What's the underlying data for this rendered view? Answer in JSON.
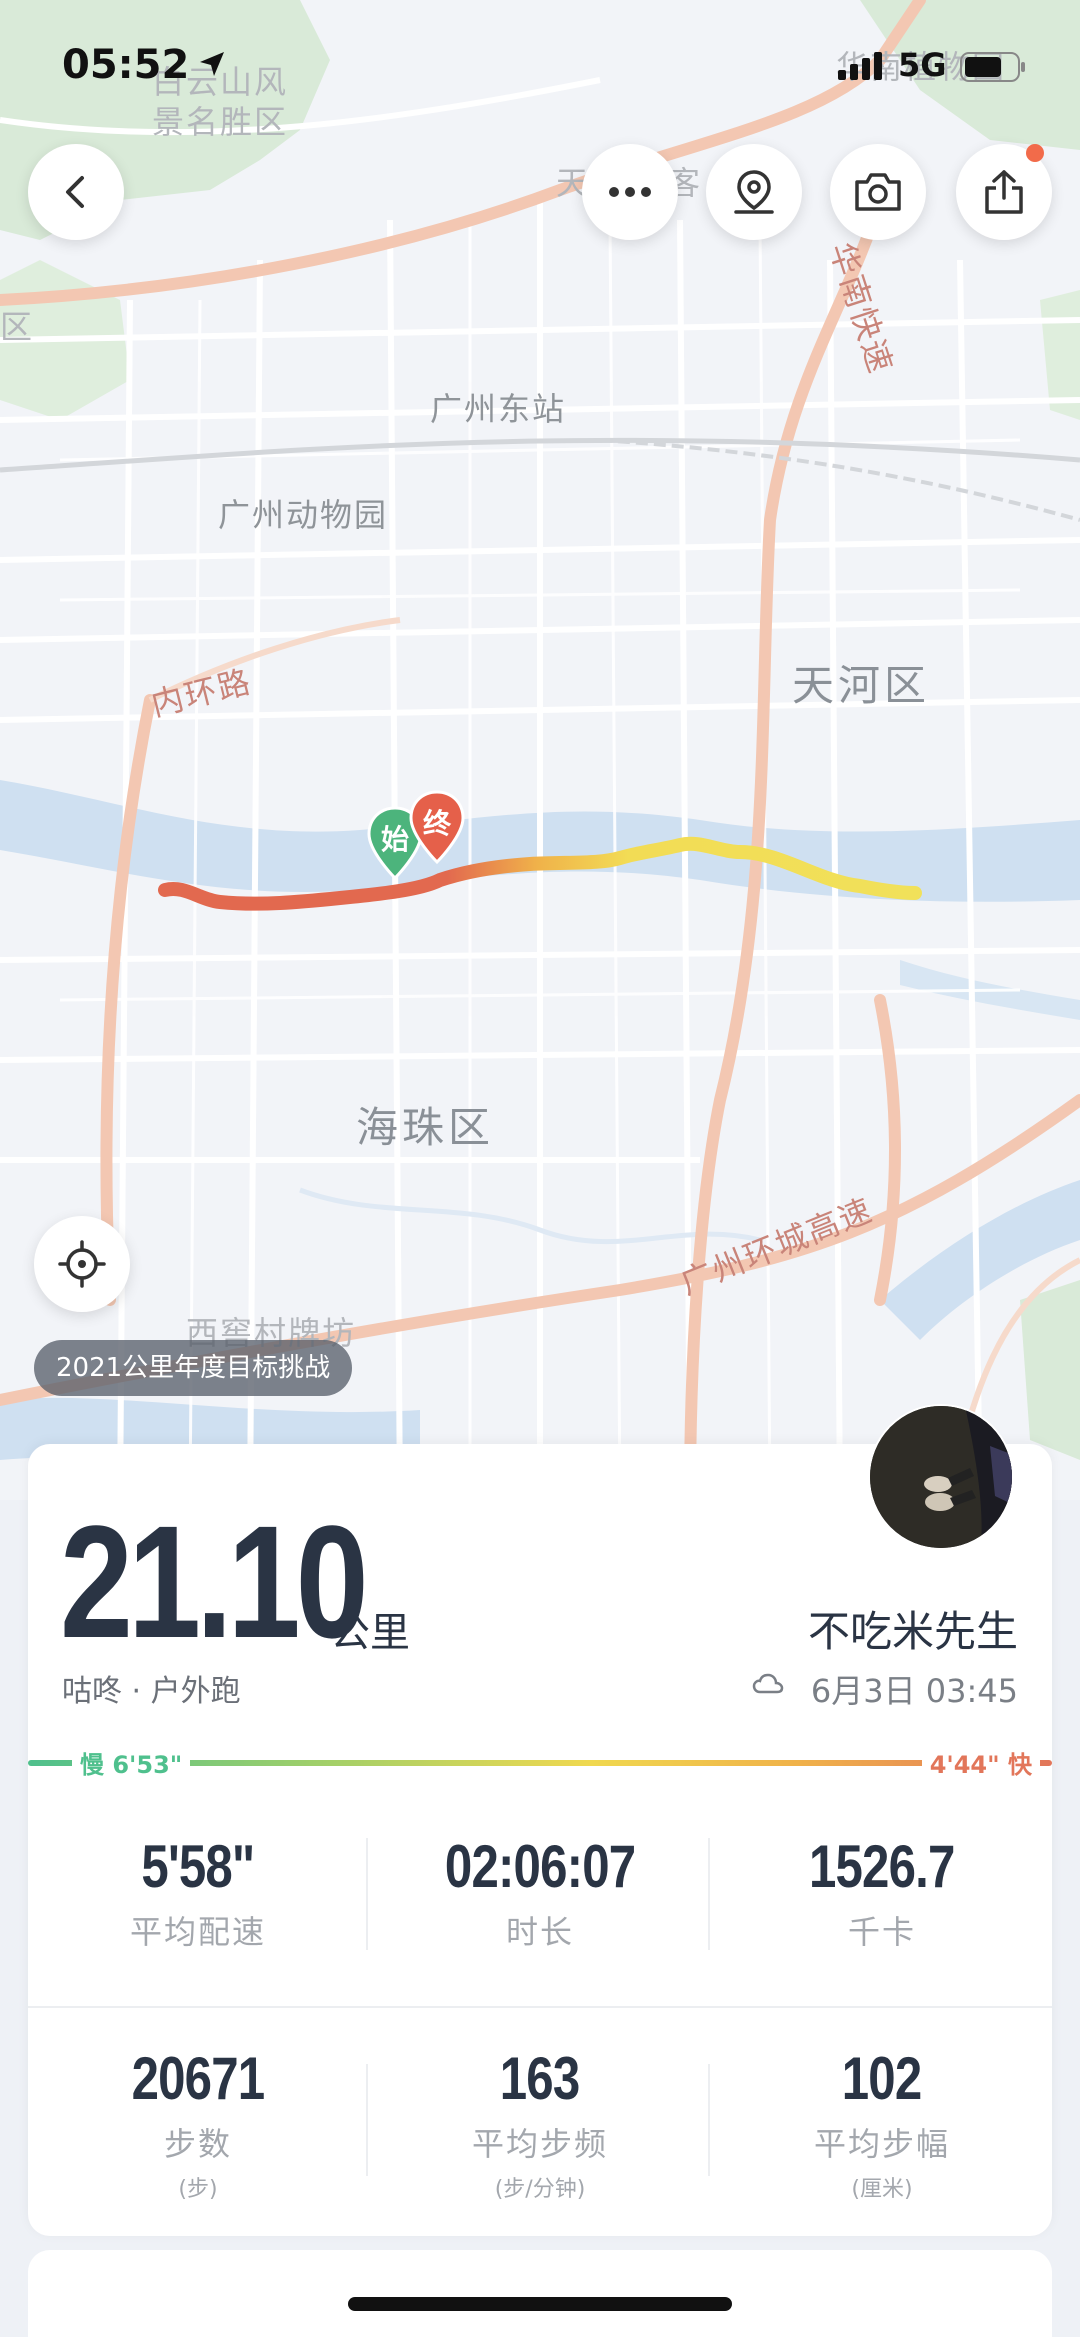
{
  "status_bar": {
    "time": "05:52",
    "network": "5G"
  },
  "map": {
    "labels": {
      "baiyun": "白云山风\n景名胜区",
      "dongzhan": "广州东站",
      "zoo": "广州动物园",
      "tianhe": "天河区",
      "haizhu": "海珠区",
      "neihuan": "内环路",
      "huanan": "华南快速",
      "ringexpress": "广州环城高速",
      "xicun": "西窖村牌坊",
      "left_qu": "区",
      "top_tian": "天",
      "top_ke": "客",
      "top_right": "华南植物园"
    },
    "start_pin": "始",
    "end_pin": "终",
    "track_colors": {
      "slow": "#e2694f",
      "mid": "#f0c94a",
      "fast": "#f2e15a"
    }
  },
  "challenge_label": "2021公里年度目标挑战",
  "activity": {
    "distance": "21.10",
    "distance_unit": "公里",
    "source": "咕咚 · 户外跑",
    "username": "不吃米先生",
    "datetime": "6月3日 03:45",
    "pace_slow": "慢 6'53\"",
    "pace_fast": "4'44\" 快"
  },
  "stats": {
    "row1": [
      {
        "value": "5'58\"",
        "label": "平均配速",
        "sub": ""
      },
      {
        "value": "02:06:07",
        "label": "时长",
        "sub": ""
      },
      {
        "value": "1526.7",
        "label": "千卡",
        "sub": ""
      }
    ],
    "row2": [
      {
        "value": "20671",
        "label": "步数",
        "sub": "(步)"
      },
      {
        "value": "163",
        "label": "平均步频",
        "sub": "(步/分钟)"
      },
      {
        "value": "102",
        "label": "平均步幅",
        "sub": "(厘米)"
      }
    ]
  }
}
